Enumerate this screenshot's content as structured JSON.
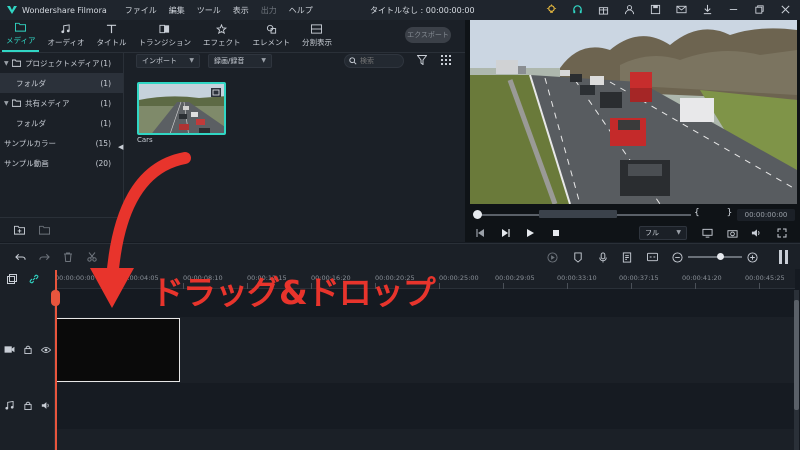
{
  "app": {
    "name": "Wondershare Filmora",
    "document_title": "タイトルなし : 00:00:00:00"
  },
  "menu": {
    "items": [
      "ファイル",
      "編集",
      "ツール",
      "表示",
      "出力",
      "ヘルプ"
    ],
    "disabled_items": [
      "出力"
    ]
  },
  "titlebar_icons": [
    "lightbulb-icon",
    "headset-icon",
    "gift-icon",
    "user-icon",
    "save-icon",
    "mail-icon",
    "download-icon",
    "minimize-icon",
    "restore-icon",
    "close-icon"
  ],
  "media_tabs": [
    {
      "label": "メディア",
      "icon": "folder-icon",
      "active": true
    },
    {
      "label": "オーディオ",
      "icon": "music-note-icon",
      "active": false
    },
    {
      "label": "タイトル",
      "icon": "text-icon",
      "active": false
    },
    {
      "label": "トランジション",
      "icon": "transition-icon",
      "active": false
    },
    {
      "label": "エフェクト",
      "icon": "effects-icon",
      "active": false
    },
    {
      "label": "エレメント",
      "icon": "elements-icon",
      "active": false
    },
    {
      "label": "分割表示",
      "icon": "split-screen-icon",
      "active": false
    }
  ],
  "export_label": "エクスポート",
  "media_tree": [
    {
      "label": "プロジェクトメディア",
      "count": "(1)",
      "level": 0,
      "caret": true
    },
    {
      "label": "フォルダ",
      "count": "(1)",
      "level": 1,
      "selected": true
    },
    {
      "label": "共有メディア",
      "count": "(1)",
      "level": 0,
      "caret": true
    },
    {
      "label": "フォルダ",
      "count": "(1)",
      "level": 1
    },
    {
      "label": "サンプルカラー",
      "count": "(15)",
      "level": 0
    },
    {
      "label": "サンプル動画",
      "count": "(20)",
      "level": 0
    }
  ],
  "media_toolbar": {
    "import_label": "インポート",
    "record_label": "録画/録音",
    "search_placeholder": "検索"
  },
  "media_items": [
    {
      "name": "Cars"
    }
  ],
  "preview": {
    "timecode": "00:00:00:00",
    "quality_label": "フル",
    "in_out_brackets": "{ }"
  },
  "timeline": {
    "ruler_labels": [
      "00:00:00:00",
      "00:00:04:05",
      "00:00:08:10",
      "00:00:12:15",
      "00:00:16:20",
      "00:00:20:25",
      "00:00:25:00",
      "00:00:29:05",
      "00:00:33:10",
      "00:00:37:15",
      "00:00:41:20",
      "00:00:45:25"
    ],
    "tracks": [
      {
        "type": "video",
        "number": "1"
      },
      {
        "type": "audio",
        "number": "1"
      }
    ]
  },
  "annotation": {
    "text": "ドラッグ&ドロップ",
    "color": "#e8342c"
  },
  "colors": {
    "accent": "#31d6c4",
    "playhead": "#e8553d"
  }
}
